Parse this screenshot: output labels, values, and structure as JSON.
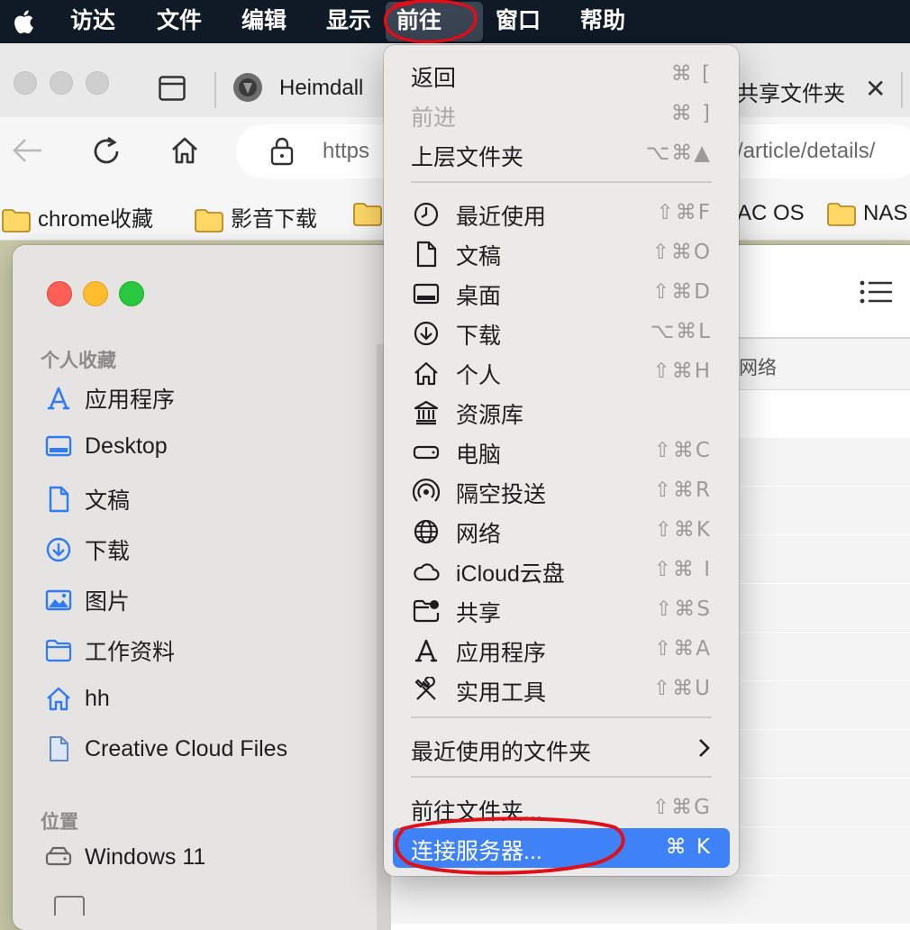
{
  "menubar": {
    "items": [
      "访达",
      "文件",
      "编辑",
      "显示",
      "前往",
      "窗口",
      "帮助"
    ],
    "active": "前往"
  },
  "browser": {
    "tab_title": "Heimdall",
    "tab_title_right": "共享文件夹",
    "url_left": "https",
    "url_right": "/article/details/",
    "bookmarks": [
      "chrome收藏",
      "影音下载",
      "AC OS",
      "NAS"
    ]
  },
  "finder": {
    "sidebar": {
      "favorites_title": "个人收藏",
      "favorites": [
        {
          "label": "应用程序",
          "icon": "apps-icon"
        },
        {
          "label": "Desktop",
          "icon": "desktop-icon"
        },
        {
          "label": "文稿",
          "icon": "document-icon"
        },
        {
          "label": "下载",
          "icon": "download-icon"
        },
        {
          "label": "图片",
          "icon": "pictures-icon"
        },
        {
          "label": "工作资料",
          "icon": "folder-icon"
        },
        {
          "label": "hh",
          "icon": "home-icon"
        },
        {
          "label": "Creative Cloud Files",
          "icon": "file-icon"
        }
      ],
      "locations_title": "位置",
      "locations": [
        {
          "label": "Windows 11",
          "icon": "drive-icon"
        }
      ]
    },
    "column_header_partial": "网络"
  },
  "go_menu": {
    "items": [
      {
        "label": "返回",
        "shortcut": "⌘ [",
        "disabled": false
      },
      {
        "label": "前进",
        "shortcut": "⌘ ]",
        "disabled": true
      },
      {
        "label": "上层文件夹",
        "shortcut": "⌥⌘▲",
        "disabled": false
      },
      {
        "label": "最近使用",
        "shortcut": "⇧⌘F",
        "icon": "clock-icon"
      },
      {
        "label": "文稿",
        "shortcut": "⇧⌘O",
        "icon": "document-icon"
      },
      {
        "label": "桌面",
        "shortcut": "⇧⌘D",
        "icon": "desktop-icon"
      },
      {
        "label": "下载",
        "shortcut": "⌥⌘L",
        "icon": "download-icon"
      },
      {
        "label": "个人",
        "shortcut": "⇧⌘H",
        "icon": "home-icon"
      },
      {
        "label": "资源库",
        "shortcut": "",
        "icon": "library-icon"
      },
      {
        "label": "电脑",
        "shortcut": "⇧⌘C",
        "icon": "computer-icon"
      },
      {
        "label": "隔空投送",
        "shortcut": "⇧⌘R",
        "icon": "airdrop-icon"
      },
      {
        "label": "网络",
        "shortcut": "⇧⌘K",
        "icon": "globe-icon"
      },
      {
        "label": "iCloud云盘",
        "shortcut": "⇧⌘ I",
        "icon": "cloud-icon"
      },
      {
        "label": "共享",
        "shortcut": "⇧⌘S",
        "icon": "shared-folder-icon"
      },
      {
        "label": "应用程序",
        "shortcut": "⇧⌘A",
        "icon": "apps-icon"
      },
      {
        "label": "实用工具",
        "shortcut": "⇧⌘U",
        "icon": "tools-icon"
      }
    ],
    "recent_folders": "最近使用的文件夹",
    "go_to_folder": {
      "label": "前往文件夹...",
      "shortcut": "⇧⌘G"
    },
    "connect_server": {
      "label": "连接服务器...",
      "shortcut": "⌘ K"
    }
  },
  "annotation_color": "#e0101a",
  "highlight_color": "#3f82f7"
}
